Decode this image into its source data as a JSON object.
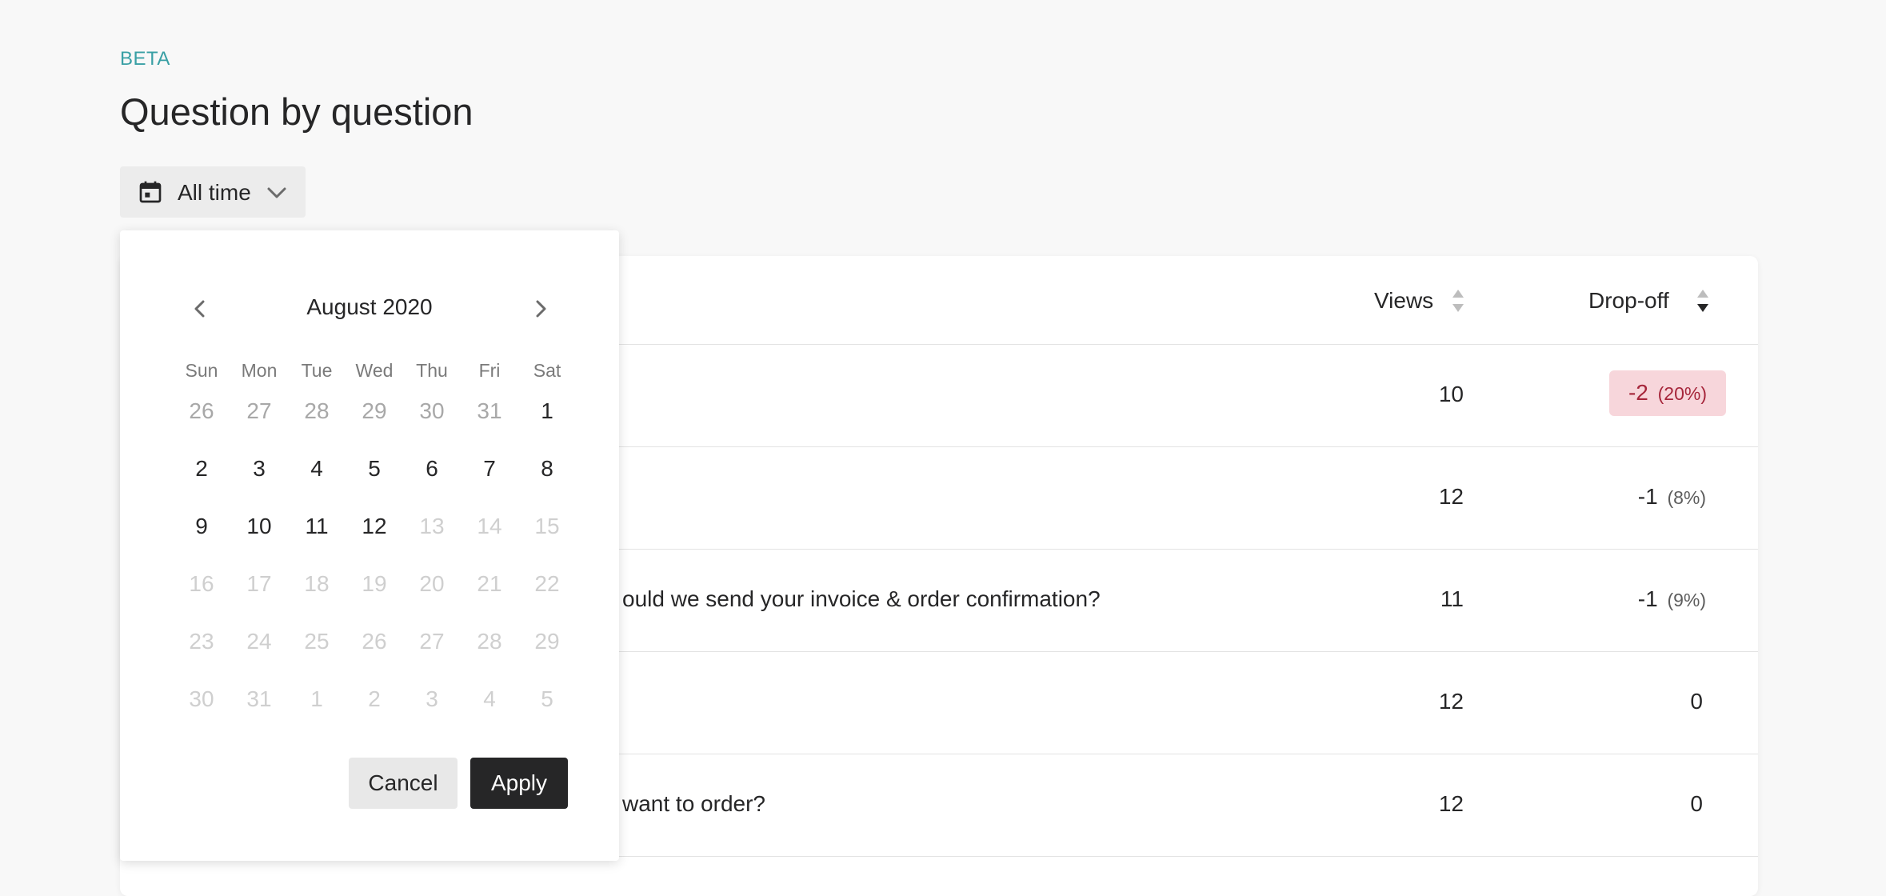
{
  "header": {
    "badge": "BETA",
    "title": "Question by question"
  },
  "date_filter": {
    "label": "All time"
  },
  "table": {
    "columns": {
      "views": "Views",
      "dropoff": "Drop-off"
    },
    "rows": [
      {
        "question": "",
        "views": "10",
        "drop": "-2",
        "pct": "(20%)",
        "highlight": true
      },
      {
        "question": "",
        "views": "12",
        "drop": "-1",
        "pct": "(8%)",
        "highlight": false
      },
      {
        "question": "ould we send your invoice & order confirmation?",
        "views": "11",
        "drop": "-1",
        "pct": "(9%)",
        "highlight": false
      },
      {
        "question": "",
        "views": "12",
        "drop": "0",
        "pct": "",
        "highlight": false
      },
      {
        "question": "want to order?",
        "views": "12",
        "drop": "0",
        "pct": "",
        "highlight": false
      }
    ]
  },
  "calendar": {
    "month_label": "August 2020",
    "weekdays": [
      "Sun",
      "Mon",
      "Tue",
      "Wed",
      "Thu",
      "Fri",
      "Sat"
    ],
    "days": [
      {
        "d": "26",
        "s": "muted"
      },
      {
        "d": "27",
        "s": "muted"
      },
      {
        "d": "28",
        "s": "muted"
      },
      {
        "d": "29",
        "s": "muted"
      },
      {
        "d": "30",
        "s": "muted"
      },
      {
        "d": "31",
        "s": "muted"
      },
      {
        "d": "1",
        "s": "active"
      },
      {
        "d": "2",
        "s": "active"
      },
      {
        "d": "3",
        "s": "active"
      },
      {
        "d": "4",
        "s": "active"
      },
      {
        "d": "5",
        "s": "active"
      },
      {
        "d": "6",
        "s": "active"
      },
      {
        "d": "7",
        "s": "active"
      },
      {
        "d": "8",
        "s": "active"
      },
      {
        "d": "9",
        "s": "active"
      },
      {
        "d": "10",
        "s": "active"
      },
      {
        "d": "11",
        "s": "active"
      },
      {
        "d": "12",
        "s": "active"
      },
      {
        "d": "13",
        "s": "disabled"
      },
      {
        "d": "14",
        "s": "disabled"
      },
      {
        "d": "15",
        "s": "disabled"
      },
      {
        "d": "16",
        "s": "disabled"
      },
      {
        "d": "17",
        "s": "disabled"
      },
      {
        "d": "18",
        "s": "disabled"
      },
      {
        "d": "19",
        "s": "disabled"
      },
      {
        "d": "20",
        "s": "disabled"
      },
      {
        "d": "21",
        "s": "disabled"
      },
      {
        "d": "22",
        "s": "disabled"
      },
      {
        "d": "23",
        "s": "disabled"
      },
      {
        "d": "24",
        "s": "disabled"
      },
      {
        "d": "25",
        "s": "disabled"
      },
      {
        "d": "26",
        "s": "disabled"
      },
      {
        "d": "27",
        "s": "disabled"
      },
      {
        "d": "28",
        "s": "disabled"
      },
      {
        "d": "29",
        "s": "disabled"
      },
      {
        "d": "30",
        "s": "disabled"
      },
      {
        "d": "31",
        "s": "disabled"
      },
      {
        "d": "1",
        "s": "disabled"
      },
      {
        "d": "2",
        "s": "disabled"
      },
      {
        "d": "3",
        "s": "disabled"
      },
      {
        "d": "4",
        "s": "disabled"
      },
      {
        "d": "5",
        "s": "disabled"
      }
    ],
    "cancel_label": "Cancel",
    "apply_label": "Apply"
  },
  "icons": {
    "date_button": "calendar-icon",
    "date_chevron": "chevron-down-icon",
    "prev_month": "chevron-left-icon",
    "next_month": "chevron-right-icon",
    "sort": "sort-icon"
  },
  "colors": {
    "accent": "#3aa0a5",
    "dropoff_badge_bg": "#f7d6db",
    "dropoff_badge_text": "#a6263b",
    "apply_button": "#262627"
  }
}
